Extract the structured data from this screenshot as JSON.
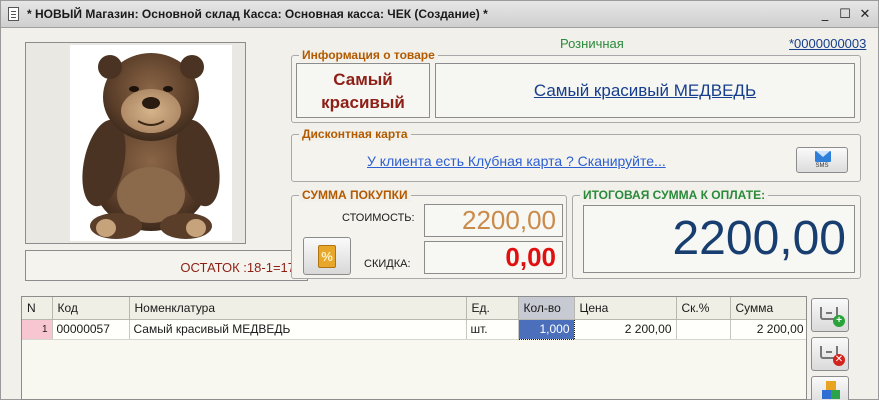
{
  "window": {
    "title": "* НОВЫЙ Магазин: Основной склад Касса: Основная касса: ЧЕК (Создание) *",
    "min_glyph": "_",
    "max_glyph": "☐",
    "close_glyph": "✕"
  },
  "header": {
    "price_type": "Розничная",
    "doc_number": "*0000000003"
  },
  "product": {
    "section_title": "Информация о товаре",
    "short_name": "Самый красивый МЕДВЕДЬ",
    "full_name": "Самый красивый МЕДВЕДЬ",
    "stock_text": "ОСТАТОК :18-1=17",
    "photo_icon": "teddy-bear-photo"
  },
  "discount_card": {
    "section_title": "Дисконтная карта",
    "link_text": "У клиента есть Клубная карта ? Сканируйте...",
    "sms_label": "SMS"
  },
  "purchase": {
    "section_title": "СУММА ПОКУПКИ",
    "cost_label": "СТОИМОСТЬ:",
    "cost_value": "2200,00",
    "discount_label": "СКИДКА:",
    "discount_value": "0,00",
    "discount_icon_glyph": "%"
  },
  "total": {
    "section_title": "ИТОГОВАЯ СУММА К ОПЛАТЕ:",
    "value": "2200,00"
  },
  "table": {
    "columns": [
      "N",
      "Код",
      "Номенклатура",
      "Ед.",
      "Кол-во",
      "Цена",
      "Ск.%",
      "Сумма"
    ],
    "rows": [
      {
        "n": "1",
        "code": "00000057",
        "name": "Самый красивый МЕДВЕДЬ",
        "unit": "шт.",
        "qty": "1,000",
        "price": "2 200,00",
        "disc": "",
        "sum": "2 200,00"
      }
    ]
  },
  "side_buttons": {
    "add_badge": "+",
    "del_badge": "✕"
  },
  "colors": {
    "window_bg": "#f1f0ea",
    "section_title": "#b35a00",
    "total_title": "#2a8a3a",
    "link_blue": "#2c5fd1",
    "dark_red": "#8e1f16",
    "navy": "#173e6e"
  }
}
